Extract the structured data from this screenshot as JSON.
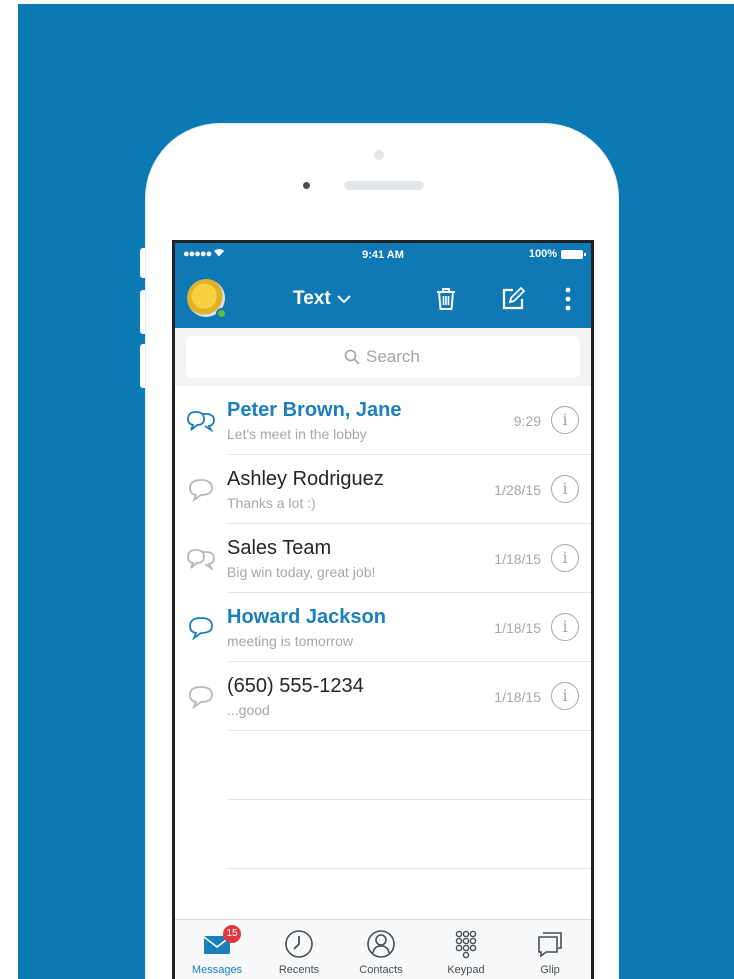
{
  "status_bar": {
    "signal": "●●●●● ",
    "time": "9:41 AM",
    "battery": "100%"
  },
  "header": {
    "title": "Text",
    "icons": [
      "trash-icon",
      "compose-icon",
      "more-vertical-icon"
    ]
  },
  "search": {
    "placeholder": "Search"
  },
  "conversations": [
    {
      "name": "Peter Brown, Jane",
      "preview": "Let's meet in the lobby",
      "time": "9:29",
      "unread": true,
      "group": true
    },
    {
      "name": "Ashley Rodriguez",
      "preview": "Thanks a lot :)",
      "time": "1/28/15",
      "unread": false,
      "group": false
    },
    {
      "name": "Sales Team",
      "preview": "Big win today, great job!",
      "time": "1/18/15",
      "unread": false,
      "group": true
    },
    {
      "name": "Howard Jackson",
      "preview": "meeting is tomorrow",
      "time": "1/18/15",
      "unread": true,
      "group": false
    },
    {
      "name": "(650) 555-1234",
      "preview": "...good",
      "time": "1/18/15",
      "unread": false,
      "group": false
    }
  ],
  "info_glyph": "i",
  "tabs": [
    {
      "label": "Messages",
      "icon": "envelope-icon",
      "badge": "15",
      "active": true
    },
    {
      "label": "Recents",
      "icon": "clock-icon"
    },
    {
      "label": "Contacts",
      "icon": "person-icon"
    },
    {
      "label": "Keypad",
      "icon": "keypad-icon"
    },
    {
      "label": "Glip",
      "icon": "chat-window-icon"
    }
  ],
  "colors": {
    "brand_blue": "#0f79b6",
    "unread_blue": "#1a7fbd",
    "badge_red": "#e0383e",
    "presence_green": "#5fbf3b"
  }
}
